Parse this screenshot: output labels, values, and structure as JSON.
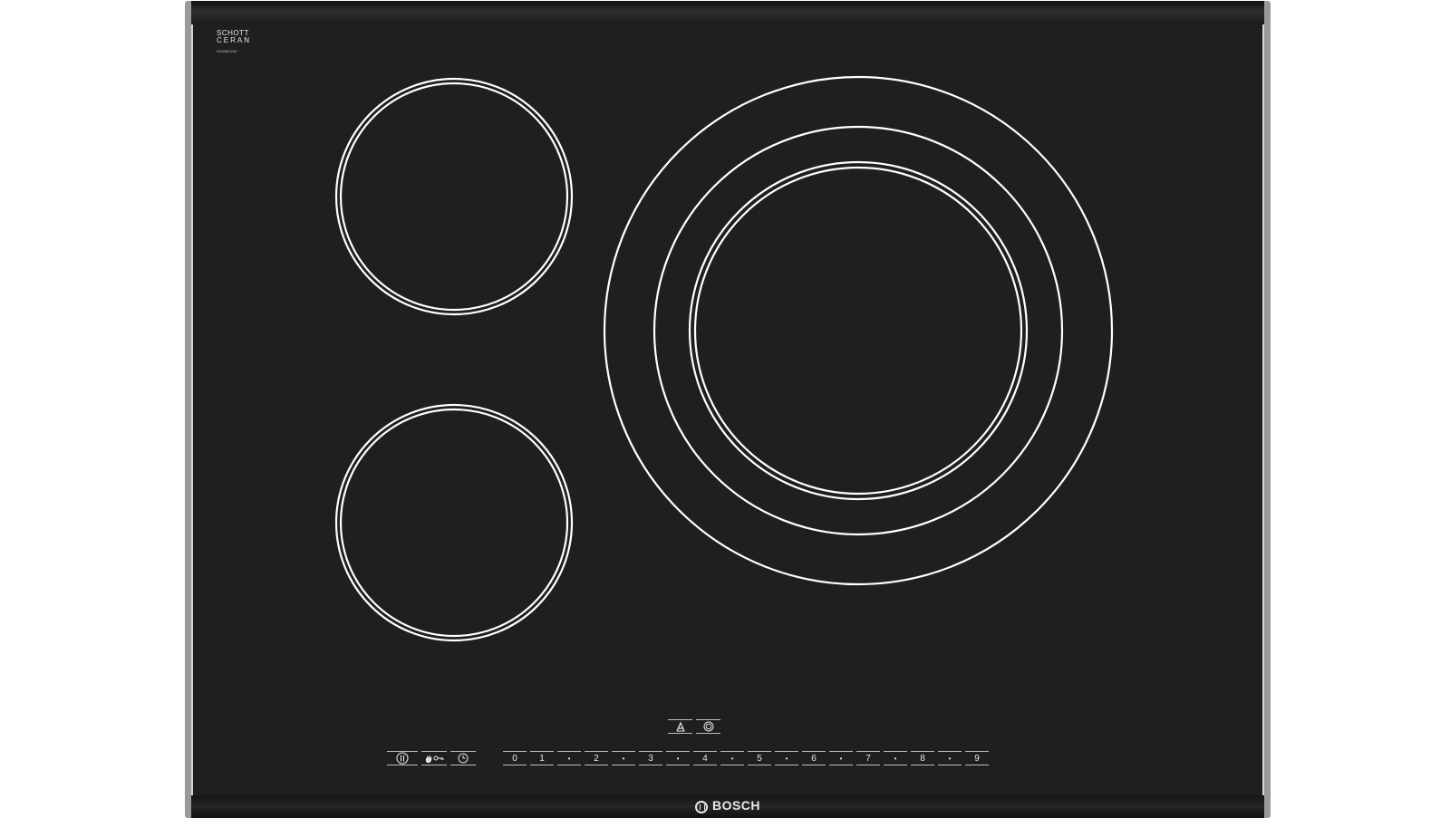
{
  "schott_logo": {
    "line1": "SCHOTT",
    "line2": "CERAN",
    "code": "9000862228"
  },
  "brand": "BOSCH",
  "power_levels": [
    "0",
    "1",
    "•",
    "2",
    "•",
    "3",
    "•",
    "4",
    "•",
    "5",
    "•",
    "6",
    "•",
    "7",
    "•",
    "8",
    "•",
    "9"
  ],
  "icons": {
    "power": "power-icon",
    "child_lock": "child-lock-icon",
    "timer": "timer-icon",
    "auto": "auto-icon",
    "zone_select": "zone-select-icon"
  },
  "colors": {
    "glass": "#1f1f1d",
    "frame": "#9a9a9a",
    "zone_line": "#ffffff"
  }
}
